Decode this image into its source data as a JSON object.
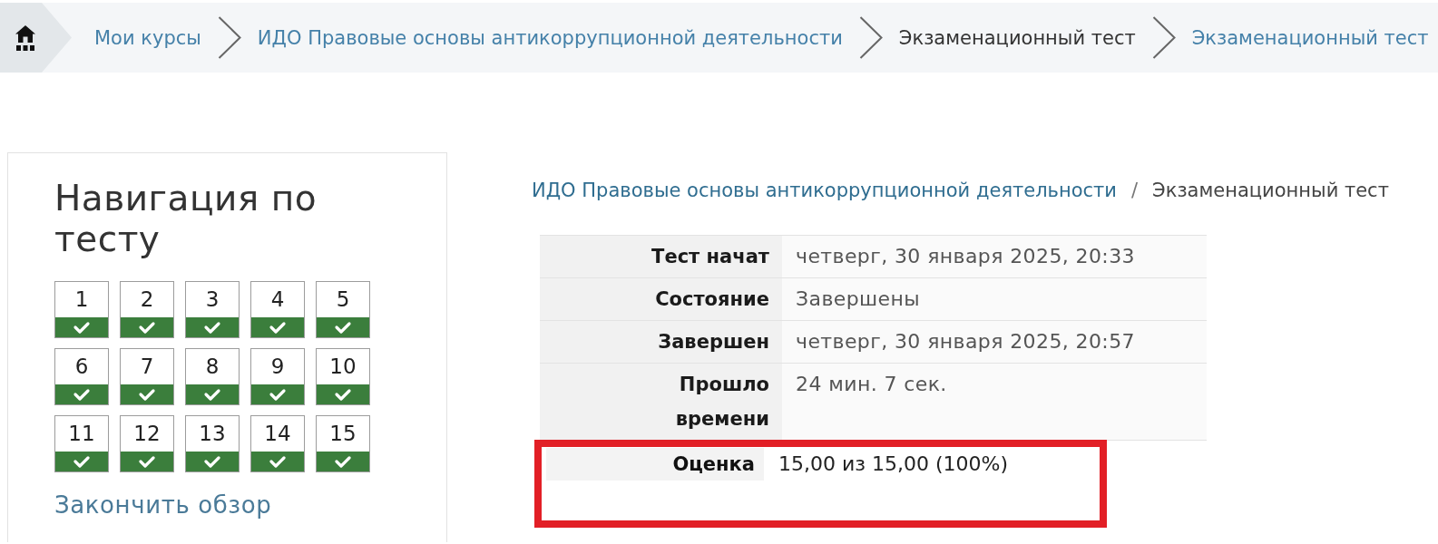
{
  "breadcrumb": {
    "items": [
      {
        "text": "Мои курсы",
        "kind": "link"
      },
      {
        "text": "ИДО Правовые основы антикоррупционной деятельности",
        "kind": "link"
      },
      {
        "text": "Экзаменационный тест",
        "kind": "plain"
      },
      {
        "text": "Экзаменационный тест",
        "kind": "link"
      }
    ]
  },
  "quiz_nav": {
    "title": "Навигация по тесту",
    "questions": [
      {
        "number": "1",
        "correct": true
      },
      {
        "number": "2",
        "correct": true
      },
      {
        "number": "3",
        "correct": true
      },
      {
        "number": "4",
        "correct": true
      },
      {
        "number": "5",
        "correct": true
      },
      {
        "number": "6",
        "correct": true
      },
      {
        "number": "7",
        "correct": true
      },
      {
        "number": "8",
        "correct": true
      },
      {
        "number": "9",
        "correct": true
      },
      {
        "number": "10",
        "correct": true
      },
      {
        "number": "11",
        "correct": true
      },
      {
        "number": "12",
        "correct": true
      },
      {
        "number": "13",
        "correct": true
      },
      {
        "number": "14",
        "correct": true
      },
      {
        "number": "15",
        "correct": true
      }
    ],
    "finish_link": "Закончить обзор"
  },
  "page_path": {
    "items": [
      {
        "text": "ИДО Правовые основы антикоррупционной деятельности",
        "kind": "link"
      },
      {
        "text": "Экзаменационный тест",
        "kind": "plain"
      }
    ],
    "separator": "/"
  },
  "summary": {
    "rows": [
      {
        "label": "Тест начат",
        "value": "четверг, 30 января 2025, 20:33",
        "kind": "field",
        "highlighted": false
      },
      {
        "label": "Состояние",
        "value": "Завершены",
        "kind": "field",
        "highlighted": false
      },
      {
        "label": "Завершен",
        "value": "четверг, 30 января 2025, 20:57",
        "kind": "field",
        "highlighted": false
      },
      {
        "label": "Прошло времени",
        "value": "24 мин. 7 сек.",
        "kind": "field",
        "highlighted": false
      },
      {
        "label": "Оценка",
        "value": "15,00 из 15,00 (100%)",
        "kind": "result",
        "highlighted": true
      }
    ]
  }
}
